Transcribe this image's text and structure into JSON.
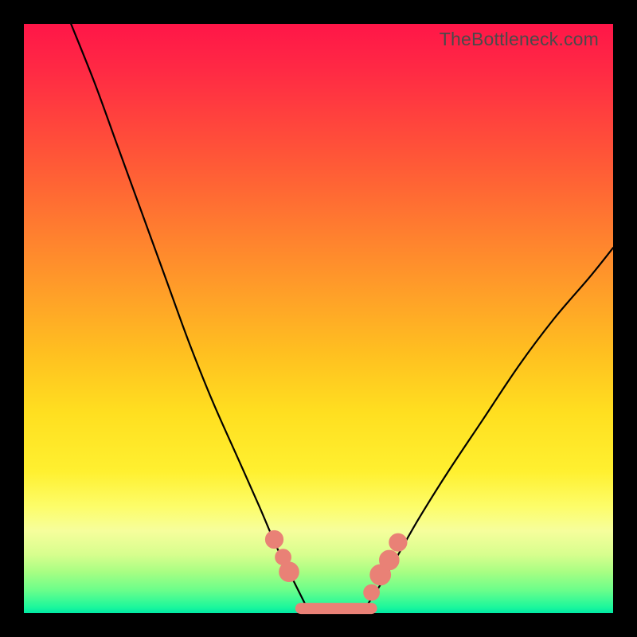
{
  "watermark": "TheBottleneck.com",
  "colors": {
    "frame": "#000000",
    "gradient_top": "#ff1648",
    "gradient_mid": "#ffdf20",
    "gradient_bottom": "#00e8a4",
    "curve": "#000000",
    "marker": "#e98176"
  },
  "chart_data": {
    "type": "line",
    "title": "",
    "xlabel": "",
    "ylabel": "",
    "xlim": [
      0,
      100
    ],
    "ylim": [
      0,
      100
    ],
    "grid": false,
    "legend": false,
    "notes": "V-shaped response curve rendered over a vertical red→yellow→green gradient. No axis tick labels are visible; x and y are normalized 0–100. Left branch steeper than right. Salmon markers cluster at the curve minimum and along both branches just above it.",
    "series": [
      {
        "name": "left-branch",
        "x": [
          8,
          12,
          16,
          20,
          24,
          28,
          32,
          36,
          40,
          43,
          46,
          48
        ],
        "y": [
          100,
          90,
          79,
          68,
          57,
          46,
          36,
          27,
          18,
          11,
          5,
          1
        ]
      },
      {
        "name": "right-branch",
        "x": [
          58,
          60,
          63,
          67,
          72,
          78,
          84,
          90,
          96,
          100
        ],
        "y": [
          1,
          4,
          9,
          16,
          24,
          33,
          42,
          50,
          57,
          62
        ]
      },
      {
        "name": "flat-minimum",
        "x": [
          48,
          58
        ],
        "y": [
          0.5,
          0.5
        ]
      }
    ],
    "markers": [
      {
        "x": 42.5,
        "y": 12.5,
        "r": 1.2
      },
      {
        "x": 44.0,
        "y": 9.5,
        "r": 1.0
      },
      {
        "x": 45.0,
        "y": 7.0,
        "r": 1.4
      },
      {
        "x": 60.5,
        "y": 6.5,
        "r": 1.5
      },
      {
        "x": 62.0,
        "y": 9.0,
        "r": 1.4
      },
      {
        "x": 63.5,
        "y": 12.0,
        "r": 1.2
      },
      {
        "x": 59.0,
        "y": 3.5,
        "r": 1.0
      }
    ],
    "minimum_band": {
      "x0": 47,
      "x1": 59,
      "y": 0.8
    }
  }
}
